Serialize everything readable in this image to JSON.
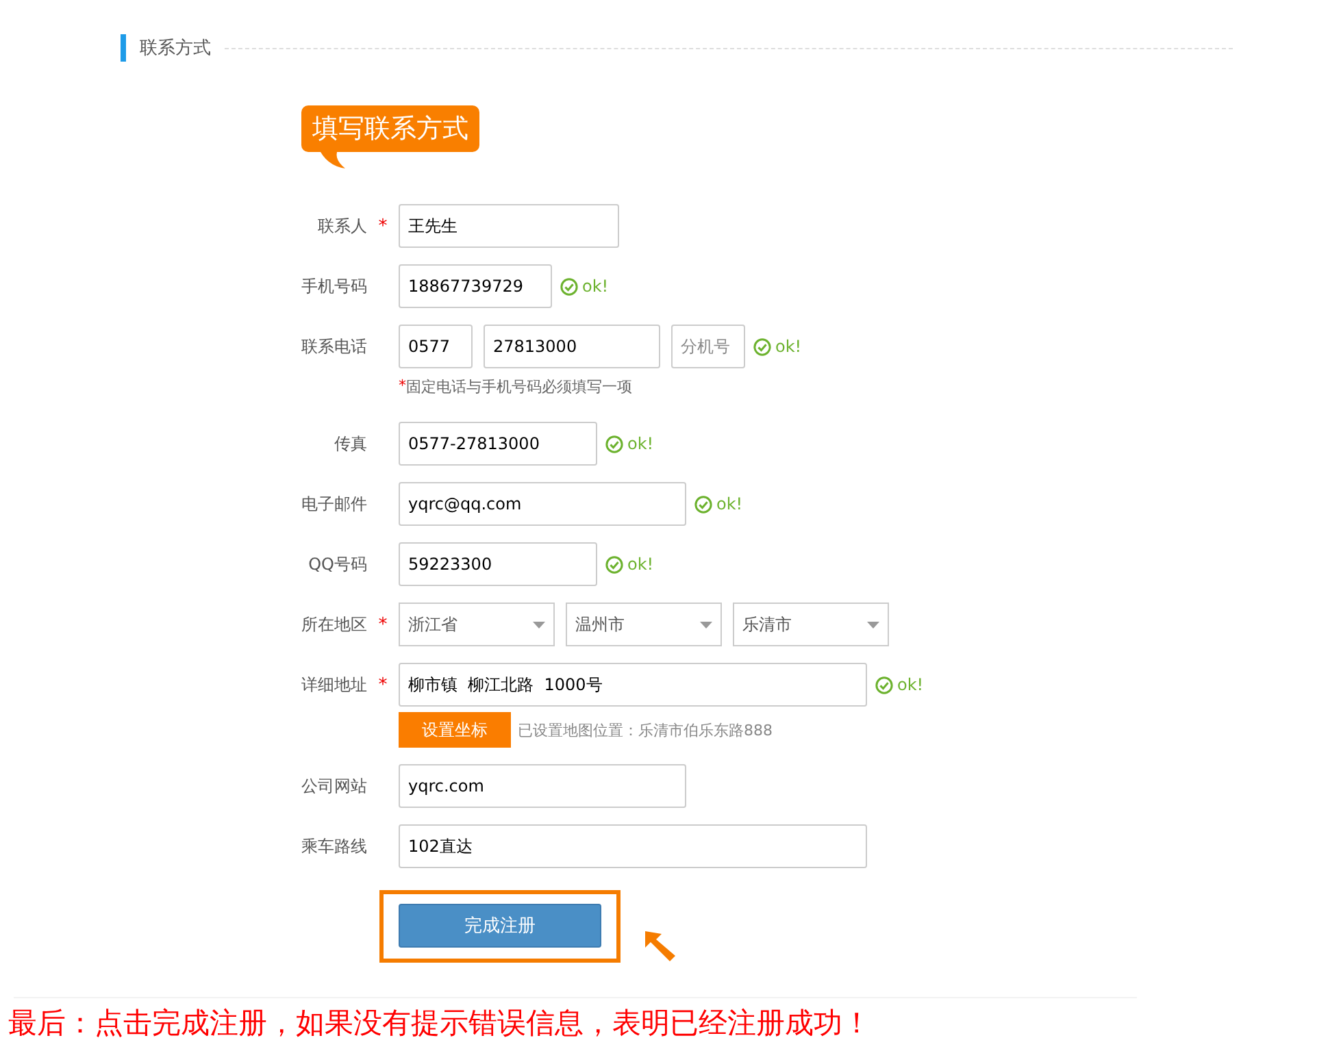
{
  "section_title": "联系方式",
  "bubble": "填写联系方式",
  "rows": [
    {
      "label": "联系人",
      "mark": "*",
      "fields": [
        {
          "kind": "input",
          "value": "王先生"
        }
      ]
    },
    {
      "label": "手机号码",
      "fields": [
        {
          "kind": "input",
          "value": "18867739729"
        }
      ],
      "status": "ok!"
    },
    {
      "label": "联系电话",
      "fields": [
        {
          "kind": "input",
          "value": "0577"
        },
        {
          "kind": "input",
          "value": "27813000"
        },
        {
          "kind": "input",
          "placeholder": "分机号"
        }
      ],
      "status": "ok!",
      "note_mark": "*",
      "note": "固定电话与手机号码必须填写一项"
    },
    {
      "label": "传真",
      "fields": [
        {
          "kind": "input",
          "value": "0577-27813000"
        }
      ],
      "status": "ok!"
    },
    {
      "label": "电子邮件",
      "fields": [
        {
          "kind": "input",
          "value": "yqrc@qq.com"
        }
      ],
      "status": "ok!"
    },
    {
      "label": "QQ号码",
      "fields": [
        {
          "kind": "input",
          "value": "59223300"
        }
      ],
      "status": "ok!"
    },
    {
      "label": "所在地区",
      "mark": "*",
      "fields": [
        {
          "kind": "select",
          "value": "浙江省"
        },
        {
          "kind": "select",
          "value": "温州市"
        },
        {
          "kind": "select",
          "value": "乐清市"
        }
      ]
    },
    {
      "label": "详细地址",
      "mark": "*",
      "fields": [
        {
          "kind": "input",
          "value": "柳市镇  柳江北路  1000号"
        }
      ],
      "status": "ok!",
      "action": {
        "button": "设置坐标",
        "info": "已设置地图位置：乐清市伯乐东路888"
      }
    },
    {
      "label": "公司网站",
      "fields": [
        {
          "kind": "input",
          "value": "yqrc.com"
        }
      ]
    },
    {
      "label": "乘车路线",
      "fields": [
        {
          "kind": "input",
          "value": "102直达"
        }
      ]
    }
  ],
  "submit": "完成注册",
  "footer": "最后：点击完成注册，如果没有提示错误信息，表明已经注册成功！"
}
